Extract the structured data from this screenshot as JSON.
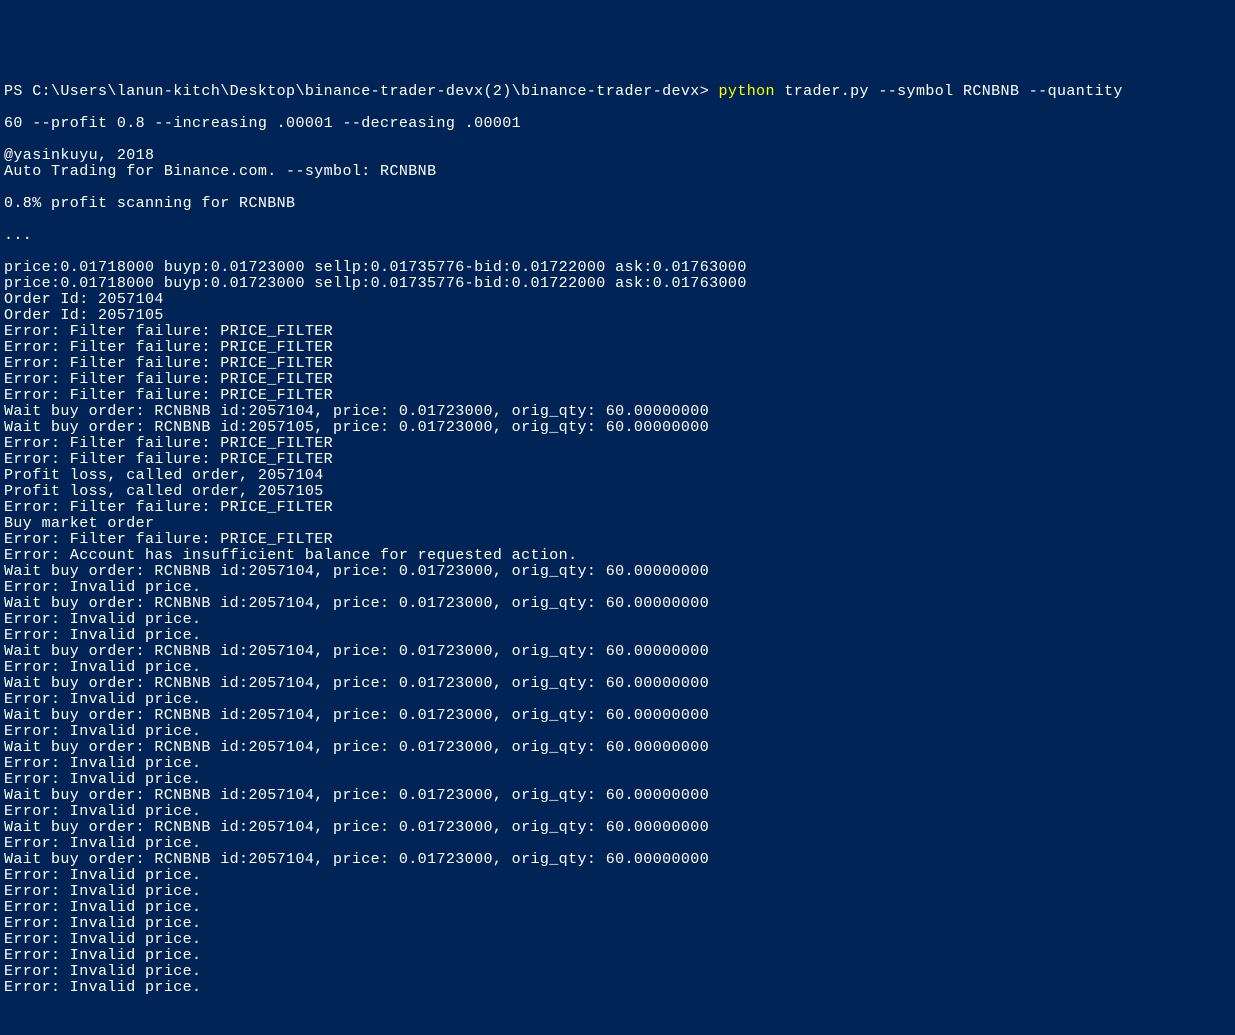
{
  "prompt_line": {
    "prompt": "PS C:\\Users\\lanun-kitch\\Desktop\\binance-trader-devx(2)\\binance-trader-devx> ",
    "python_cmd": "python ",
    "args_line1": "trader.py --symbol RCNBNB --quantity",
    "args_line2": "60 --profit 0.8 --increasing .00001 --decreasing .00001"
  },
  "output": [
    "@yasinkuyu, 2018",
    "Auto Trading for Binance.com. --symbol: RCNBNB",
    "",
    "0.8% profit scanning for RCNBNB",
    "",
    "...",
    "",
    "price:0.01718000 buyp:0.01723000 sellp:0.01735776-bid:0.01722000 ask:0.01763000",
    "price:0.01718000 buyp:0.01723000 sellp:0.01735776-bid:0.01722000 ask:0.01763000",
    "Order Id: 2057104",
    "Order Id: 2057105",
    "Error: Filter failure: PRICE_FILTER",
    "Error: Filter failure: PRICE_FILTER",
    "Error: Filter failure: PRICE_FILTER",
    "Error: Filter failure: PRICE_FILTER",
    "Error: Filter failure: PRICE_FILTER",
    "Wait buy order: RCNBNB id:2057104, price: 0.01723000, orig_qty: 60.00000000",
    "Wait buy order: RCNBNB id:2057105, price: 0.01723000, orig_qty: 60.00000000",
    "Error: Filter failure: PRICE_FILTER",
    "Error: Filter failure: PRICE_FILTER",
    "Profit loss, called order, 2057104",
    "Profit loss, called order, 2057105",
    "Error: Filter failure: PRICE_FILTER",
    "Buy market order",
    "Error: Filter failure: PRICE_FILTER",
    "Error: Account has insufficient balance for requested action.",
    "Wait buy order: RCNBNB id:2057104, price: 0.01723000, orig_qty: 60.00000000",
    "Error: Invalid price.",
    "Wait buy order: RCNBNB id:2057104, price: 0.01723000, orig_qty: 60.00000000",
    "Error: Invalid price.",
    "Error: Invalid price.",
    "Wait buy order: RCNBNB id:2057104, price: 0.01723000, orig_qty: 60.00000000",
    "Error: Invalid price.",
    "Wait buy order: RCNBNB id:2057104, price: 0.01723000, orig_qty: 60.00000000",
    "Error: Invalid price.",
    "Wait buy order: RCNBNB id:2057104, price: 0.01723000, orig_qty: 60.00000000",
    "Error: Invalid price.",
    "Wait buy order: RCNBNB id:2057104, price: 0.01723000, orig_qty: 60.00000000",
    "Error: Invalid price.",
    "Error: Invalid price.",
    "Wait buy order: RCNBNB id:2057104, price: 0.01723000, orig_qty: 60.00000000",
    "Error: Invalid price.",
    "Wait buy order: RCNBNB id:2057104, price: 0.01723000, orig_qty: 60.00000000",
    "Error: Invalid price.",
    "Wait buy order: RCNBNB id:2057104, price: 0.01723000, orig_qty: 60.00000000",
    "Error: Invalid price.",
    "Error: Invalid price.",
    "Error: Invalid price.",
    "Error: Invalid price.",
    "Error: Invalid price.",
    "Error: Invalid price.",
    "Error: Invalid price.",
    "Error: Invalid price."
  ]
}
